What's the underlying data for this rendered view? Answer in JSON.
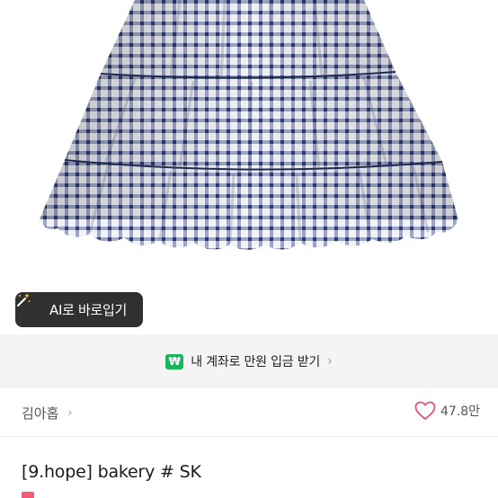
{
  "ai_button": {
    "label": "AI로 바로입기",
    "icon": "magic-wand-icon"
  },
  "banner": {
    "icon_text": "₩",
    "text": "내 계좌로 만원 입금 받기",
    "chevron": "›"
  },
  "shop": {
    "name": "김아홉",
    "chevron": "›"
  },
  "likes": {
    "count": "47.8만",
    "icon": "heart-outline-icon"
  },
  "product": {
    "title": "[9.hope] bakery # SK"
  },
  "colors": {
    "accent_pink": "#e0546f",
    "won_green": "#19b55c",
    "gingham": "#3d4f86"
  }
}
